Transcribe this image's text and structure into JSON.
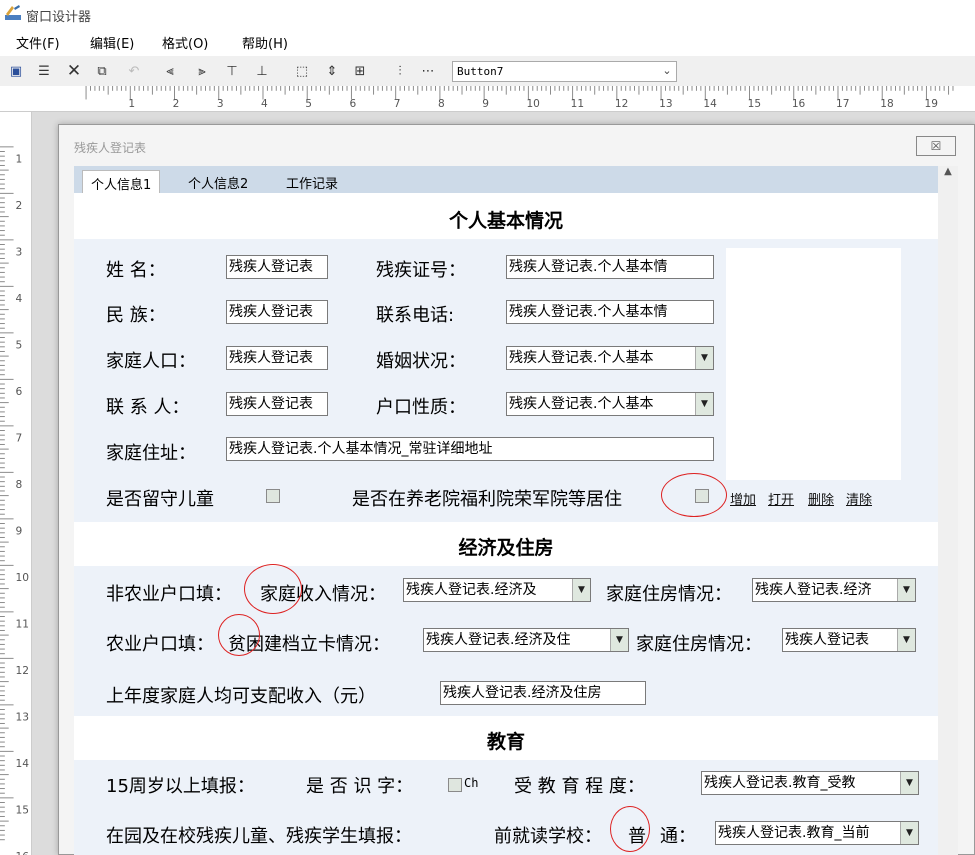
{
  "app": {
    "title": "窗口设计器"
  },
  "menubar": {
    "file": "文件(F)",
    "edit": "编辑(E)",
    "format": "格式(O)",
    "help": "帮助(H)"
  },
  "toolbar": {
    "combo_value": "Button7"
  },
  "ruler": {
    "h_numbers": [
      "1",
      "2",
      "3",
      "4",
      "5",
      "6",
      "7",
      "8",
      "9",
      "10",
      "11",
      "12",
      "13",
      "14",
      "15",
      "16",
      "17",
      "18",
      "19"
    ],
    "v_numbers": [
      "1",
      "2",
      "3",
      "4",
      "5",
      "6",
      "7",
      "8",
      "9",
      "10",
      "11",
      "12",
      "13",
      "14",
      "15",
      "16"
    ]
  },
  "window": {
    "title": "残疾人登记表",
    "close_glyph": "☒",
    "tabs": [
      "个人信息1",
      "个人信息2",
      "工作记录"
    ]
  },
  "sections": {
    "basic": "个人基本情况",
    "economy": "经济及住房",
    "education": "教育"
  },
  "basic": {
    "name_label": "姓 名：",
    "name_value": "残疾人登记表",
    "cert_label": "残疾证号：",
    "cert_value": "残疾人登记表.个人基本情",
    "nation_label": "民 族：",
    "nation_value": "残疾人登记表",
    "phone_label": "联系电话:",
    "phone_value": "残疾人登记表.个人基本情",
    "family_label": "家庭人口：",
    "family_value": "残疾人登记表",
    "marriage_label": "婚姻状况：",
    "marriage_value": "残疾人登记表.个人基本",
    "contact_label": "联 系 人：",
    "contact_value": "残疾人登记表",
    "hukou_label": "户口性质：",
    "hukou_value": "残疾人登记表.个人基本",
    "address_label": "家庭住址：",
    "address_value": "残疾人登记表.个人基本情况_常驻详细地址",
    "leftbehind_label": "是否留守儿童",
    "nursing_label": "是否在养老院福利院荣军院等居住",
    "links": [
      "增加",
      "打开",
      "删除",
      "清除"
    ]
  },
  "economy": {
    "nonagri_label": "非农业户口填：",
    "nonagri_income_label": "家庭收入情况：",
    "nonagri_income_value": "残疾人登记表.经济及",
    "nonagri_house_label": "家庭住房情况：",
    "nonagri_house_value": "残疾人登记表.经济",
    "agri_label": "农业户口填：",
    "agri_poor_label": "贫困建档立卡情况：",
    "agri_poor_value": "残疾人登记表.经济及住",
    "agri_house_label": "家庭住房情况：",
    "agri_house_value": "残疾人登记表",
    "income_label": "上年度家庭人均可支配收入（元）",
    "income_value": "残疾人登记表.经济及住房"
  },
  "education": {
    "over15_label": "15周岁以上填报：",
    "literate_label": "是 否 识 字：",
    "literate_check_text": "Ch",
    "degree_label": "受 教 育 程 度：",
    "degree_value": "残疾人登记表.教育_受教",
    "student_label": "在园及在校残疾儿童、残疾学生填报：",
    "school_label": "前就读学校：",
    "school_frag": "普",
    "school_type": "通：",
    "school_value": "残疾人登记表.教育_当前"
  }
}
